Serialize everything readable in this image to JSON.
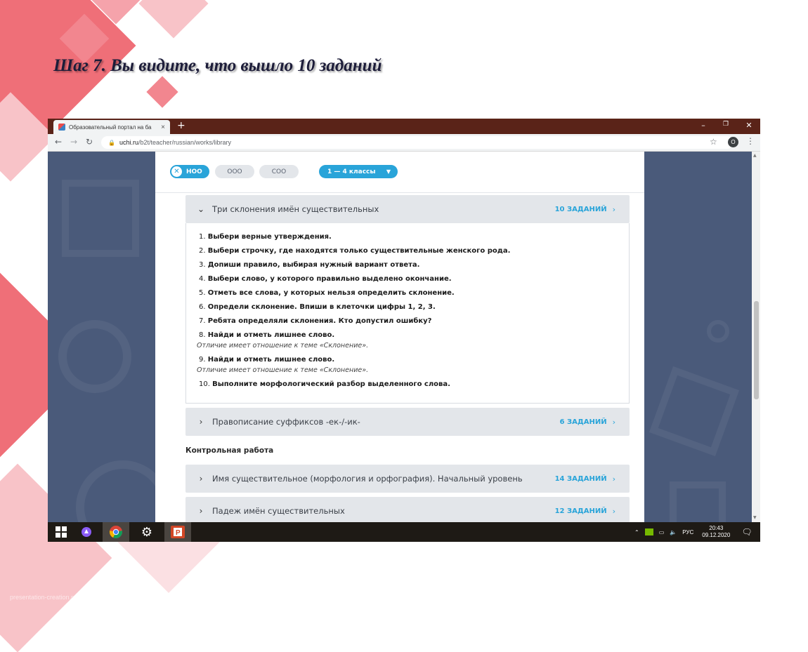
{
  "slide": {
    "title": "Шаг 7. Вы видите, что вышло 10 заданий",
    "watermark": "presentation-creation.ru"
  },
  "browser": {
    "tab_title": "Образовательный портал на ба",
    "tab_close": "×",
    "new_tab": "+",
    "url_host": "uchi.ru",
    "url_path": "/b2t/teacher/russian/works/library",
    "profile_initial": "O"
  },
  "filters": {
    "levels": [
      {
        "label": "НОО",
        "active": true
      },
      {
        "label": "ООО",
        "active": false
      },
      {
        "label": "СОО",
        "active": false
      }
    ],
    "grade": "1 — 4 классы"
  },
  "topics": [
    {
      "title": "Три склонения имён существительных",
      "count": "10 ЗАДАНИЙ",
      "expanded": true
    },
    {
      "title": "Правописание суффиксов -ек-/-ик-",
      "count": "6 ЗАДАНИЙ",
      "expanded": false
    }
  ],
  "tasks": [
    {
      "num": "1.",
      "text": "Выбери верные утверждения.",
      "note": ""
    },
    {
      "num": "2.",
      "text": "Выбери строчку, где находятся только существительные женского рода.",
      "note": ""
    },
    {
      "num": "3.",
      "text": "Допиши правило, выбирая нужный вариант ответа.",
      "note": ""
    },
    {
      "num": "4.",
      "text": "Выбери слово, у которого правильно выделено окончание.",
      "note": ""
    },
    {
      "num": "5.",
      "text": "Отметь все слова, у которых нельзя определить склонение.",
      "note": ""
    },
    {
      "num": "6.",
      "text": "Определи склонение. Впиши в клеточки цифры 1, 2, 3.",
      "note": ""
    },
    {
      "num": "7.",
      "text": "Ребята определяли склонения. Кто допустил ошибку?",
      "note": ""
    },
    {
      "num": "8.",
      "text": "Найди и отметь лишнее слово.",
      "note": "Отличие имеет отношение к теме «Склонение»."
    },
    {
      "num": "9.",
      "text": "Найди и отметь лишнее слово.",
      "note": "Отличие имеет отношение к теме «Склонение»."
    },
    {
      "num": "10.",
      "text": "Выполните морфологический разбор выделенного слова.",
      "note": ""
    }
  ],
  "control_section": {
    "heading": "Контрольная работа",
    "topics": [
      {
        "title": "Имя существительное (морфология и орфография). Начальный уровень",
        "count": "14 ЗАДАНИЙ"
      },
      {
        "title": "Падеж имён существительных",
        "count": "12 ЗАДАНИЙ"
      }
    ]
  },
  "taskbar": {
    "lang": "РУС",
    "time": "20:43",
    "date": "09.12.2020"
  },
  "colors": {
    "accent": "#29a4d9",
    "titlebar": "#5a2318",
    "page_bg": "#4a5a7a"
  }
}
